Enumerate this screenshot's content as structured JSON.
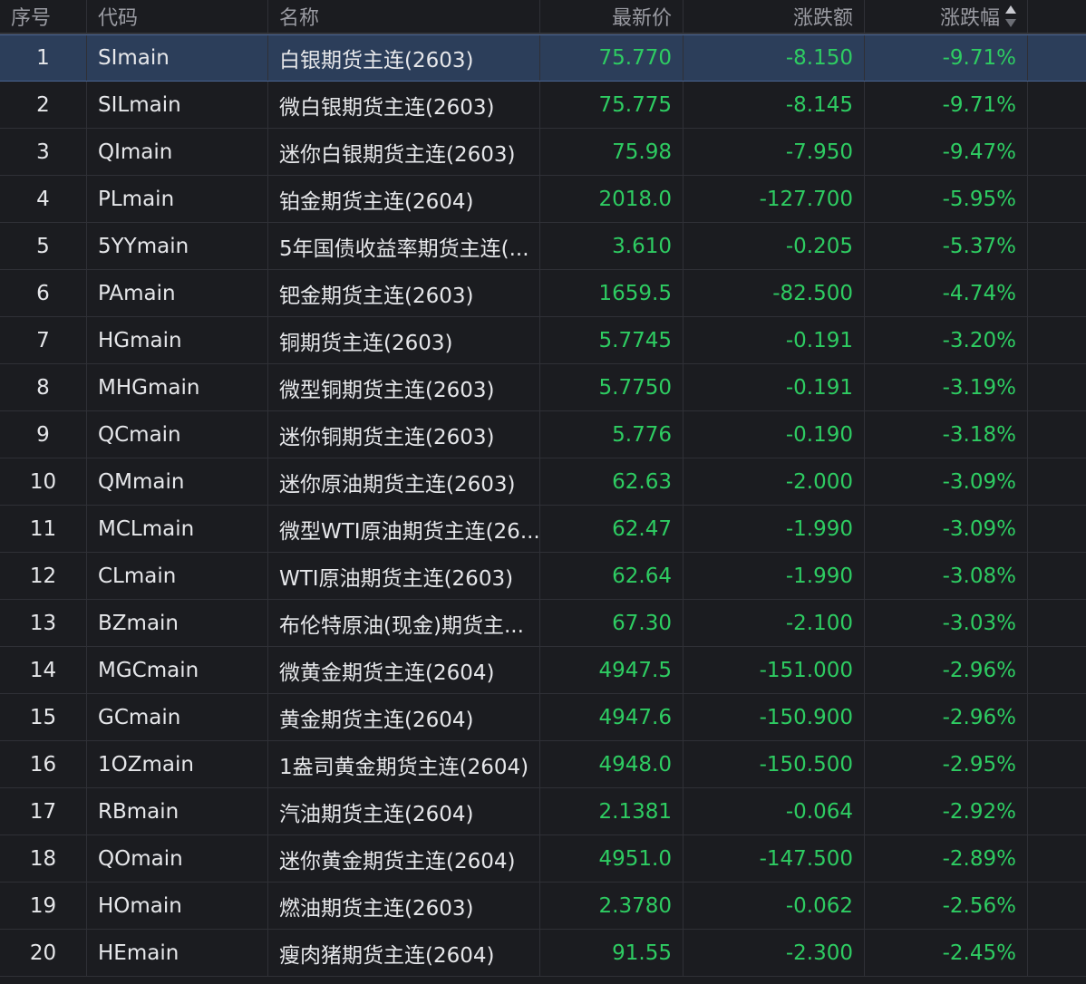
{
  "colors": {
    "background": "#1b1c20",
    "selected_row": "#2c3e5a",
    "down_green": "#2ecc62",
    "header_text": "#9a9ba2"
  },
  "header": {
    "index": "序号",
    "code": "代码",
    "name": "名称",
    "price": "最新价",
    "change": "涨跌额",
    "change_pct": "涨跌幅",
    "sort_icon": "sort-updown-icon"
  },
  "rows": [
    {
      "index": "1",
      "code": "SImain",
      "name": "白银期货主连(2603)",
      "price": "75.770",
      "change": "-8.150",
      "change_pct": "-9.71%"
    },
    {
      "index": "2",
      "code": "SILmain",
      "name": "微白银期货主连(2603)",
      "price": "75.775",
      "change": "-8.145",
      "change_pct": "-9.71%"
    },
    {
      "index": "3",
      "code": "QImain",
      "name": "迷你白银期货主连(2603)",
      "price": "75.98",
      "change": "-7.950",
      "change_pct": "-9.47%"
    },
    {
      "index": "4",
      "code": "PLmain",
      "name": "铂金期货主连(2604)",
      "price": "2018.0",
      "change": "-127.700",
      "change_pct": "-5.95%"
    },
    {
      "index": "5",
      "code": "5YYmain",
      "name": "5年国债收益率期货主连(...",
      "price": "3.610",
      "change": "-0.205",
      "change_pct": "-5.37%"
    },
    {
      "index": "6",
      "code": "PAmain",
      "name": "钯金期货主连(2603)",
      "price": "1659.5",
      "change": "-82.500",
      "change_pct": "-4.74%"
    },
    {
      "index": "7",
      "code": "HGmain",
      "name": "铜期货主连(2603)",
      "price": "5.7745",
      "change": "-0.191",
      "change_pct": "-3.20%"
    },
    {
      "index": "8",
      "code": "MHGmain",
      "name": "微型铜期货主连(2603)",
      "price": "5.7750",
      "change": "-0.191",
      "change_pct": "-3.19%"
    },
    {
      "index": "9",
      "code": "QCmain",
      "name": "迷你铜期货主连(2603)",
      "price": "5.776",
      "change": "-0.190",
      "change_pct": "-3.18%"
    },
    {
      "index": "10",
      "code": "QMmain",
      "name": "迷你原油期货主连(2603)",
      "price": "62.63",
      "change": "-2.000",
      "change_pct": "-3.09%"
    },
    {
      "index": "11",
      "code": "MCLmain",
      "name": "微型WTI原油期货主连(26...",
      "price": "62.47",
      "change": "-1.990",
      "change_pct": "-3.09%"
    },
    {
      "index": "12",
      "code": "CLmain",
      "name": "WTI原油期货主连(2603)",
      "price": "62.64",
      "change": "-1.990",
      "change_pct": "-3.08%"
    },
    {
      "index": "13",
      "code": "BZmain",
      "name": "布伦特原油(现金)期货主...",
      "price": "67.30",
      "change": "-2.100",
      "change_pct": "-3.03%"
    },
    {
      "index": "14",
      "code": "MGCmain",
      "name": "微黄金期货主连(2604)",
      "price": "4947.5",
      "change": "-151.000",
      "change_pct": "-2.96%"
    },
    {
      "index": "15",
      "code": "GCmain",
      "name": "黄金期货主连(2604)",
      "price": "4947.6",
      "change": "-150.900",
      "change_pct": "-2.96%"
    },
    {
      "index": "16",
      "code": "1OZmain",
      "name": "1盎司黄金期货主连(2604)",
      "price": "4948.0",
      "change": "-150.500",
      "change_pct": "-2.95%"
    },
    {
      "index": "17",
      "code": "RBmain",
      "name": "汽油期货主连(2604)",
      "price": "2.1381",
      "change": "-0.064",
      "change_pct": "-2.92%"
    },
    {
      "index": "18",
      "code": "QOmain",
      "name": "迷你黄金期货主连(2604)",
      "price": "4951.0",
      "change": "-147.500",
      "change_pct": "-2.89%"
    },
    {
      "index": "19",
      "code": "HOmain",
      "name": "燃油期货主连(2603)",
      "price": "2.3780",
      "change": "-0.062",
      "change_pct": "-2.56%"
    },
    {
      "index": "20",
      "code": "HEmain",
      "name": "瘦肉猪期货主连(2604)",
      "price": "91.55",
      "change": "-2.300",
      "change_pct": "-2.45%"
    }
  ],
  "selected_row_index": 0
}
